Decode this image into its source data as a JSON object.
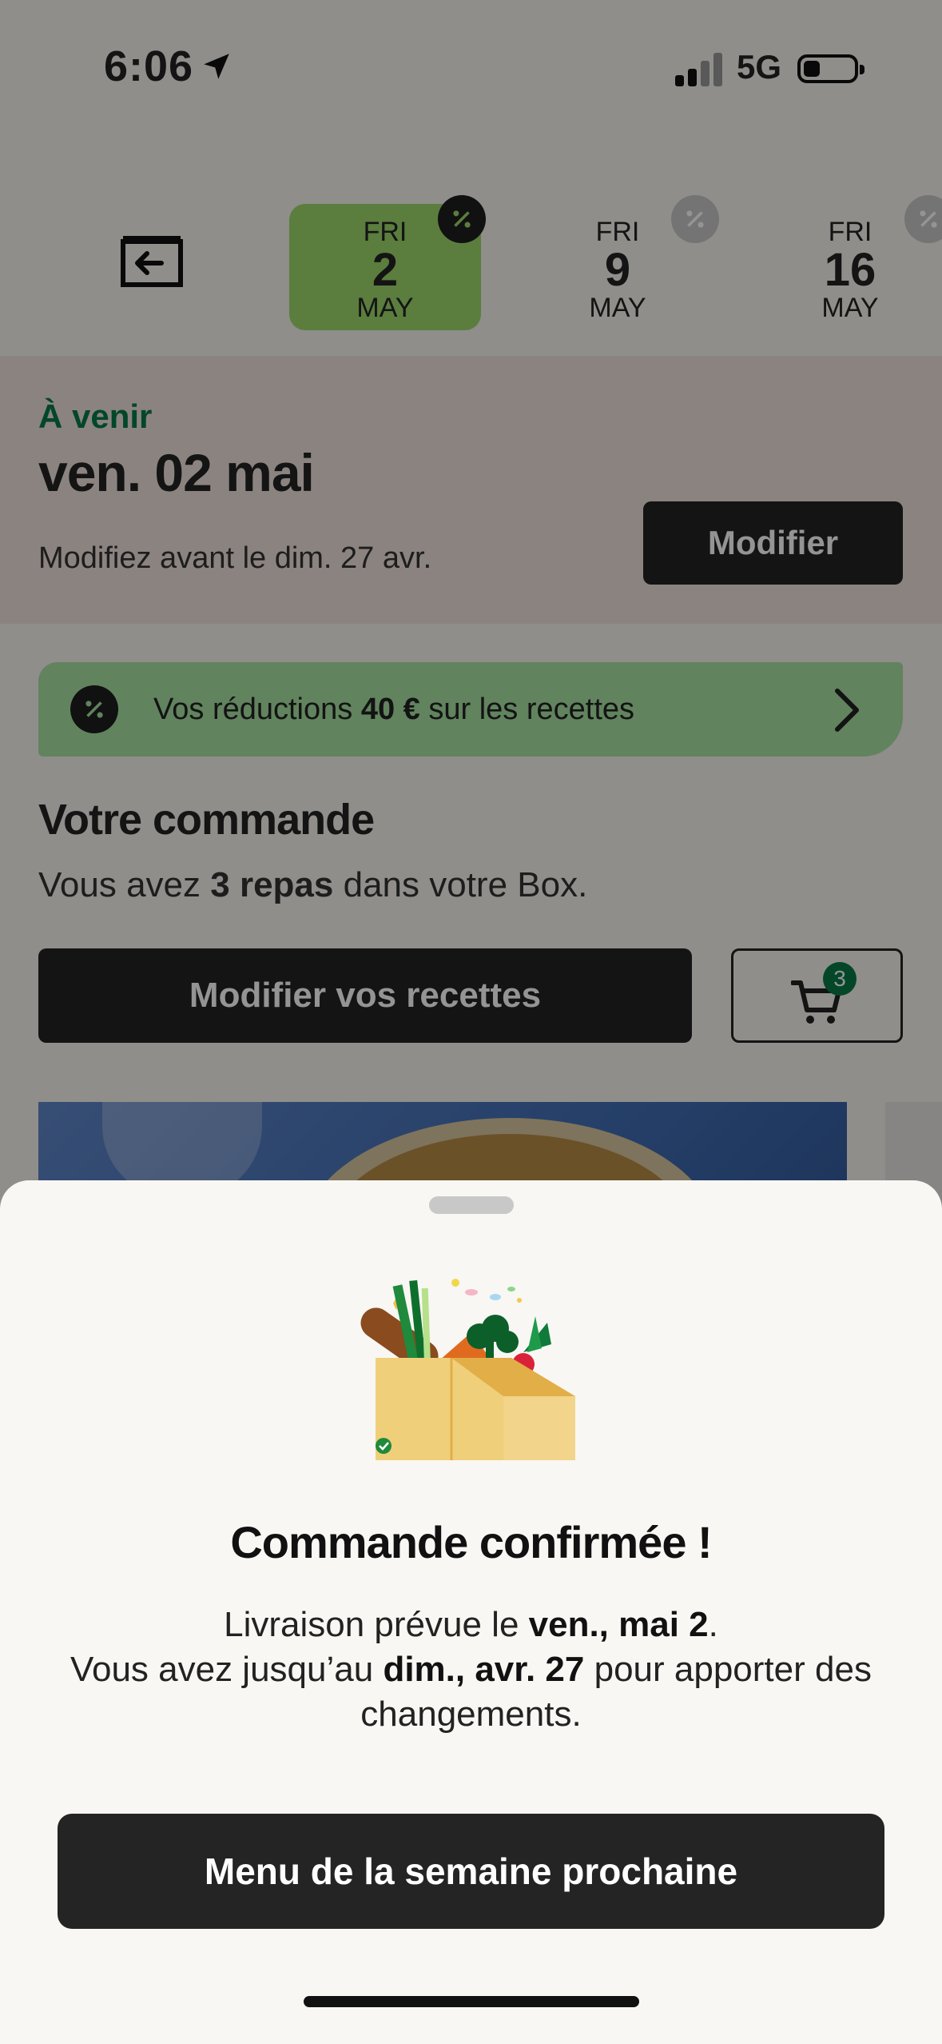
{
  "status_bar": {
    "time": "6:06",
    "network": "5G"
  },
  "date_tabs": [
    {
      "dow": "FRI",
      "day": "2",
      "month": "MAY",
      "active": true
    },
    {
      "dow": "FRI",
      "day": "9",
      "month": "MAY",
      "active": false
    },
    {
      "dow": "FRI",
      "day": "16",
      "month": "MAY",
      "active": false
    }
  ],
  "upcoming": {
    "label": "À venir",
    "date": "ven. 02 mai",
    "deadline": "Modifiez avant le  dim. 27 avr.",
    "modify_button": "Modifier"
  },
  "discount": {
    "prefix": "Vos réductions ",
    "amount": "40 €",
    "suffix": " sur les recettes"
  },
  "order": {
    "title": "Votre commande",
    "sub_prefix": "Vous avez ",
    "sub_bold": "3 repas",
    "sub_suffix": " dans votre Box.",
    "recipes_button": "Modifier vos recettes",
    "cart_count": "3"
  },
  "sheet": {
    "title": "Commande confirmée !",
    "line1_prefix": "Livraison prévue le ",
    "line1_bold": "ven., mai 2",
    "line1_suffix": ".",
    "line2_prefix": "Vous avez jusqu’au ",
    "line2_bold": "dim., avr. 27",
    "line2_suffix": " pour apporter des changements.",
    "next_button": "Menu de la semaine prochaine"
  }
}
